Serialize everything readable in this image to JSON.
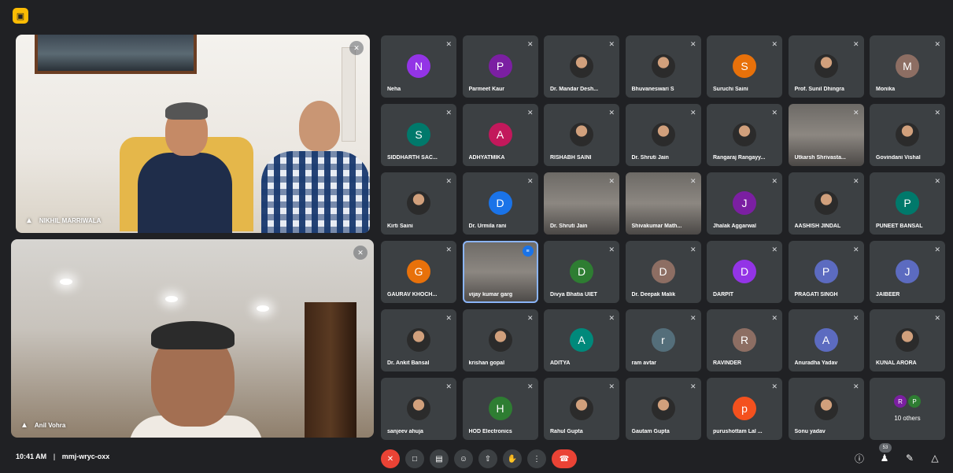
{
  "pinned": [
    {
      "name": "NIKHIL MARRIWALA"
    },
    {
      "name": "Anil Vohra"
    }
  ],
  "participants": [
    {
      "name": "Neha",
      "initial": "N",
      "color": "#9334e6",
      "kind": "initial"
    },
    {
      "name": "Parmeet Kaur",
      "initial": "P",
      "color": "#7b1fa2",
      "kind": "initial"
    },
    {
      "name": "Dr. Mandar Desh...",
      "kind": "photo"
    },
    {
      "name": "Bhuvaneswari S",
      "kind": "photo"
    },
    {
      "name": "Suruchi Saini",
      "initial": "S",
      "color": "#e8710a",
      "kind": "initial"
    },
    {
      "name": "Prof. Sunil Dhingra",
      "kind": "photo"
    },
    {
      "name": "Monika",
      "initial": "M",
      "color": "#8d6e63",
      "kind": "initial"
    },
    {
      "name": "SIDDHARTH SAC...",
      "initial": "S",
      "color": "#00796b",
      "kind": "initial"
    },
    {
      "name": "ADHYATMIKA",
      "initial": "A",
      "color": "#c2185b",
      "kind": "initial"
    },
    {
      "name": "RISHABH SAINI",
      "kind": "photo"
    },
    {
      "name": "Dr. Shruti Jain",
      "kind": "photo"
    },
    {
      "name": "Rangaraj Rangayy...",
      "kind": "photo"
    },
    {
      "name": "Utkarsh Shrivasta...",
      "kind": "video"
    },
    {
      "name": "Govindani Vishal",
      "kind": "photo"
    },
    {
      "name": "Kirti Saini",
      "kind": "photo"
    },
    {
      "name": "Dr. Urmila rani",
      "initial": "D",
      "color": "#1a73e8",
      "kind": "initial"
    },
    {
      "name": "Dr. Shruti Jain",
      "kind": "video"
    },
    {
      "name": "Shivakumar Math...",
      "kind": "video"
    },
    {
      "name": "Jhalak Aggarwal",
      "initial": "J",
      "color": "#7b1fa2",
      "kind": "initial"
    },
    {
      "name": "AASHISH JINDAL",
      "kind": "photo"
    },
    {
      "name": "PUNEET BANSAL",
      "initial": "P",
      "color": "#00796b",
      "kind": "initial"
    },
    {
      "name": "GAURAV KHOCH...",
      "initial": "G",
      "color": "#e8710a",
      "kind": "initial"
    },
    {
      "name": "vijay kumar garg",
      "kind": "video",
      "active": true
    },
    {
      "name": "Divya Bhatia UIET",
      "initial": "D",
      "color": "#2e7d32",
      "kind": "initial"
    },
    {
      "name": "Dr. Deepak Malik",
      "initial": "D",
      "color": "#8d6e63",
      "kind": "initial"
    },
    {
      "name": "DARPIT",
      "initial": "D",
      "color": "#9334e6",
      "kind": "initial"
    },
    {
      "name": "PRAGATI SINGH",
      "initial": "P",
      "color": "#5c6bc0",
      "kind": "initial"
    },
    {
      "name": "JAIBEER",
      "initial": "J",
      "color": "#5c6bc0",
      "kind": "initial"
    },
    {
      "name": "Dr. Ankit Bansal",
      "kind": "photo"
    },
    {
      "name": "krishan gopal",
      "kind": "photo"
    },
    {
      "name": "ADITYA",
      "initial": "A",
      "color": "#00897b",
      "kind": "initial"
    },
    {
      "name": "ram avtar",
      "initial": "r",
      "color": "#546e7a",
      "kind": "initial"
    },
    {
      "name": "RAVINDER",
      "initial": "R",
      "color": "#8d6e63",
      "kind": "initial"
    },
    {
      "name": "Anuradha Yadav",
      "initial": "A",
      "color": "#5c6bc0",
      "kind": "initial"
    },
    {
      "name": "KUNAL ARORA",
      "kind": "photo"
    },
    {
      "name": "sanjeev ahuja",
      "kind": "photo"
    },
    {
      "name": "HOD Electronics",
      "initial": "H",
      "color": "#2e7d32",
      "kind": "initial"
    },
    {
      "name": "Rahul Gupta",
      "kind": "photo"
    },
    {
      "name": "Gautam Gupta",
      "kind": "photo"
    },
    {
      "name": "purushottam Lal ...",
      "initial": "p",
      "color": "#f4511e",
      "kind": "initial"
    }
  ],
  "sonu": {
    "name": "Sonu yadav"
  },
  "others": {
    "label": "10 others",
    "a": "R",
    "b": "P",
    "a_color": "#7b1fa2",
    "b_color": "#2e7d32"
  },
  "bottom": {
    "time": "10:41 AM",
    "separator": "|",
    "meeting_code": "mmj-wryc-oxx",
    "people_count": "53"
  },
  "icons": {
    "top_badge": "presentation-off-icon",
    "mic_off": "mic-off-icon",
    "camera": "camera-icon",
    "captions": "captions-icon",
    "emoji": "emoji-icon",
    "present": "present-icon",
    "hand": "raise-hand-icon",
    "more": "more-vert-icon",
    "end_call": "end-call-icon",
    "info": "info-icon",
    "people": "people-icon",
    "chat": "chat-icon",
    "activities": "activities-icon"
  }
}
